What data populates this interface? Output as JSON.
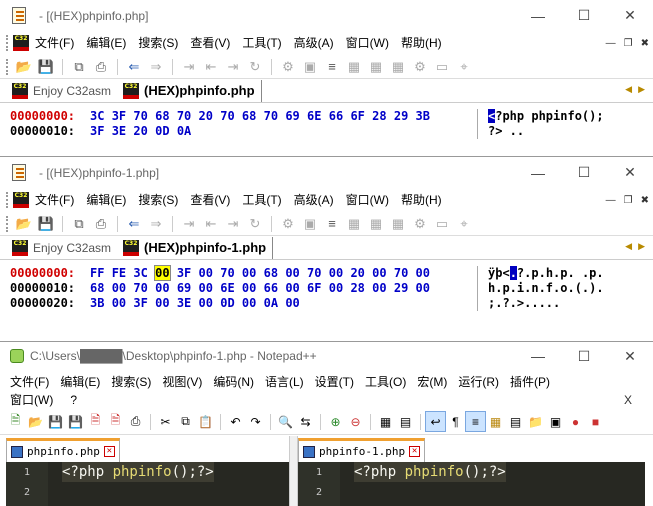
{
  "hex1": {
    "title": "[(HEX)phpinfo.php]",
    "menu": [
      "文件(F)",
      "编辑(E)",
      "搜索(S)",
      "查看(V)",
      "工具(T)",
      "高级(A)",
      "窗口(W)",
      "帮助(H)"
    ],
    "tabs": [
      "Enjoy C32asm",
      "(HEX)phpinfo.php"
    ],
    "offsets": [
      "00000000:",
      "00000010:"
    ],
    "bytes": [
      [
        "3C",
        "3F",
        "70",
        "68",
        "70",
        "20",
        "70",
        "68",
        "70",
        "69",
        "6E",
        "66",
        "6F",
        "28",
        "29",
        "3B"
      ],
      [
        "3F",
        "3E",
        "20",
        "0D",
        "0A"
      ]
    ],
    "ascii_cursor": "<",
    "ascii": [
      "?php phpinfo();",
      "?> .."
    ]
  },
  "hex2": {
    "title": "[(HEX)phpinfo-1.php]",
    "menu": [
      "文件(F)",
      "编辑(E)",
      "搜索(S)",
      "查看(V)",
      "工具(T)",
      "高级(A)",
      "窗口(W)",
      "帮助(H)"
    ],
    "tabs": [
      "Enjoy C32asm",
      "(HEX)phpinfo-1.php"
    ],
    "offsets": [
      "00000000:",
      "00000010:",
      "00000020:"
    ],
    "bytes": [
      [
        "FF",
        "FE",
        "3C",
        "00",
        "3F",
        "00",
        "70",
        "00",
        "68",
        "00",
        "70",
        "00",
        "20",
        "00",
        "70",
        "00"
      ],
      [
        "68",
        "00",
        "70",
        "00",
        "69",
        "00",
        "6E",
        "00",
        "66",
        "00",
        "6F",
        "00",
        "28",
        "00",
        "29",
        "00"
      ],
      [
        "3B",
        "00",
        "3F",
        "00",
        "3E",
        "00",
        "0D",
        "00",
        "0A",
        "00"
      ]
    ],
    "ascii_row0_prefix": "ÿþ<",
    "ascii_row0_cursor": ".",
    "ascii_row0_rest": "?.p.h.p. .p.",
    "ascii_rest": [
      "h.p.i.n.f.o.(.).",
      ";.?.>....."
    ]
  },
  "notepad": {
    "title": "C:\\Users\\█████\\Desktop\\phpinfo-1.php - Notepad++",
    "menu_row1": [
      "文件(F)",
      "编辑(E)",
      "搜索(S)",
      "视图(V)",
      "编码(N)",
      "语言(L)",
      "设置(T)",
      "工具(O)",
      "宏(M)",
      "运行(R)",
      "插件(P)"
    ],
    "menu_row2": [
      "窗口(W)",
      "?"
    ],
    "close_label": "X",
    "tab_left": "phpinfo.php",
    "tab_right": "phpinfo-1.php",
    "line_numbers": [
      "1",
      "2"
    ],
    "code_open": "<?php ",
    "code_fn": "phpinfo",
    "code_close": "();?>"
  }
}
